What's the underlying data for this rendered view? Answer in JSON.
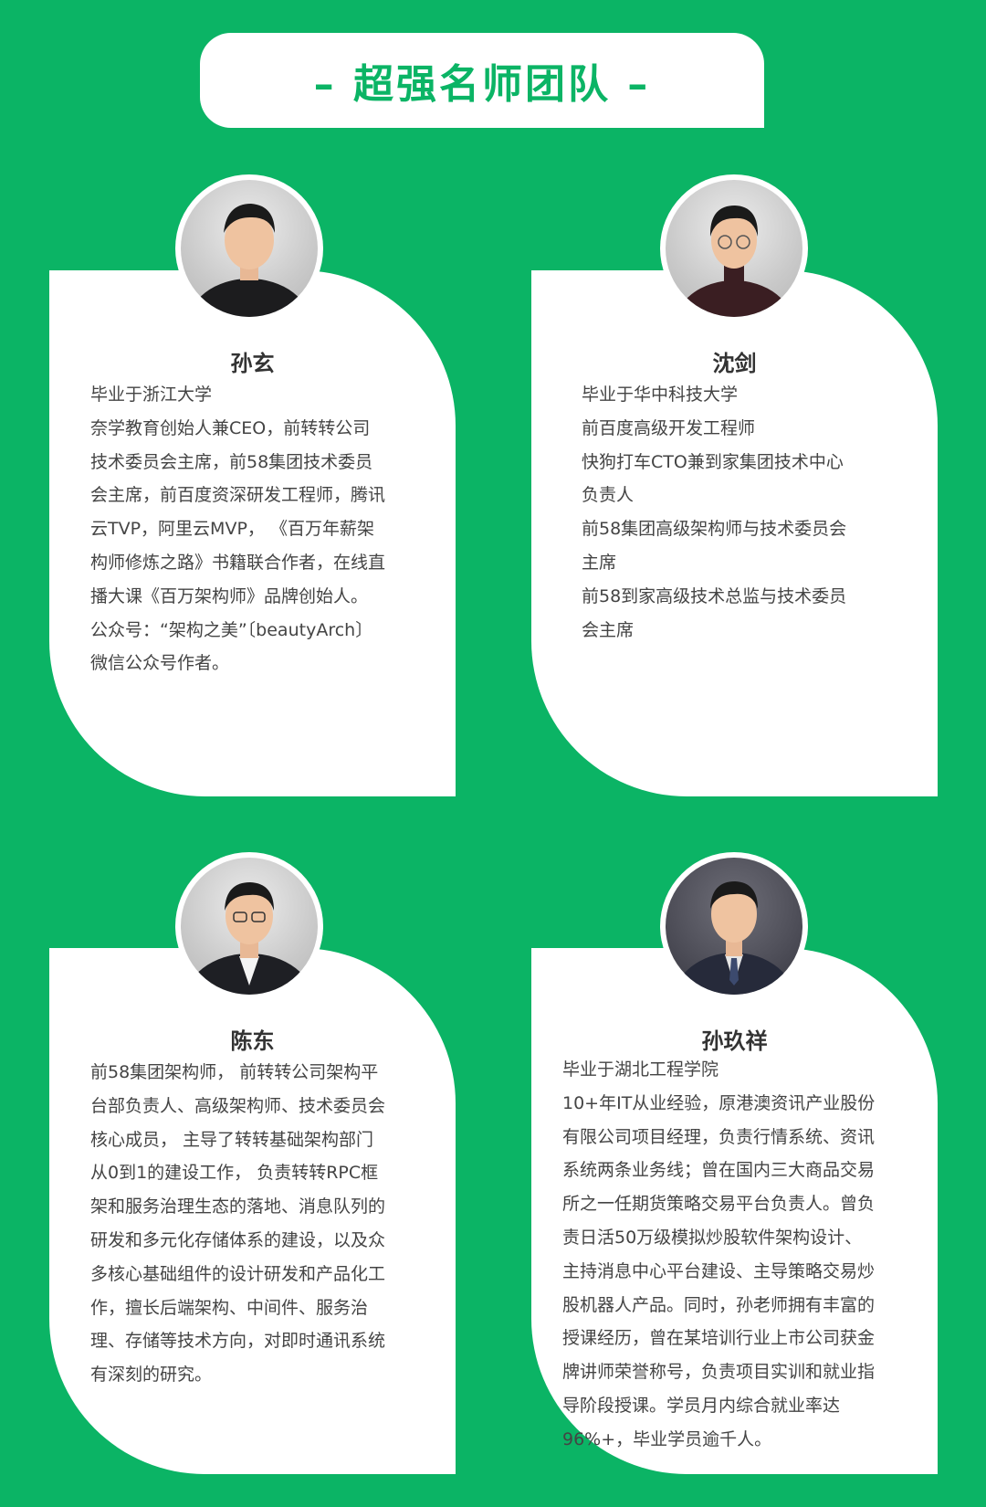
{
  "title": "– 超强名师团队 –",
  "teachers": [
    {
      "name": "孙玄",
      "bio": [
        "毕业于浙江大学",
        "奈学教育创始人兼CEO，前转转公司",
        "技术委员会主席，前58集团技术委员",
        "会主席，前百度资深研发工程师，腾讯",
        "云TVP，阿里云MVP， 《百万年薪架",
        "构师修炼之路》书籍联合作者，在线直",
        "播大课《百万架构师》品牌创始人。",
        "公众号：“架构之美”〔beautyArch〕",
        "微信公众号作者。"
      ]
    },
    {
      "name": "沈剑",
      "bio": [
        "毕业于华中科技大学",
        "前百度高级开发工程师",
        "快狗打车CTO兼到家集团技术中心",
        "负责人",
        "前58集团高级架构师与技术委员会",
        "主席",
        "前58到家高级技术总监与技术委员",
        "会主席"
      ]
    },
    {
      "name": "陈东",
      "bio": [
        "前58集团架构师， 前转转公司架构平",
        "台部负责人、高级架构师、技术委员会",
        "核心成员， 主导了转转基础架构部门",
        "从0到1的建设工作， 负责转转RPC框",
        "架和服务治理生态的落地、消息队列的",
        "研发和多元化存储体系的建设，以及众",
        "多核心基础组件的设计研发和产品化工",
        "作，擅长后端架构、中间件、服务治",
        "理、存储等技术方向，对即时通讯系统",
        "有深刻的研究。"
      ]
    },
    {
      "name": "孙玖祥",
      "bio": [
        "毕业于湖北工程学院",
        "10+年IT从业经验，原港澳资讯产业股份",
        "有限公司项目经理，负责行情系统、资讯",
        "系统两条业务线；曾在国内三大商品交易",
        "所之一任期货策略交易平台负责人。曾负",
        "责日活50万级模拟炒股软件架构设计、",
        "主持消息中心平台建设、主导策略交易炒",
        "股机器人产品。同时，孙老师拥有丰富的",
        "授课经历，曾在某培训行业上市公司获金",
        "牌讲师荣誉称号，负责项目实训和就业指",
        "导阶段授课。学员月内综合就业率达",
        "96%+，毕业学员逾千人。"
      ]
    }
  ]
}
